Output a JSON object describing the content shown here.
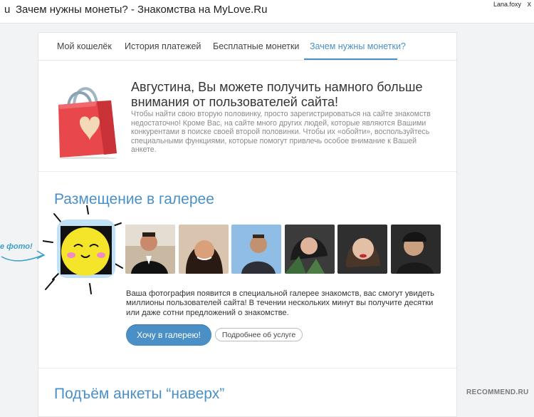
{
  "browser": {
    "tab_fragment": "u",
    "title": "Зачем нужны монеты? - Знакомства на MyLove.Ru",
    "user": "Lana.foxy",
    "close_glyph": "x"
  },
  "tabs": [
    {
      "label": "Мой кошелёк",
      "active": false
    },
    {
      "label": "История платежей",
      "active": false
    },
    {
      "label": "Бесплатные монетки",
      "active": false
    },
    {
      "label": "Зачем нужны монетки?",
      "active": true
    }
  ],
  "intro": {
    "headline": "Августина, Вы можете получить намного больше внимания от пользователей сайта!",
    "text": "Чтобы найти свою вторую половинку, просто зарегистрироваться на сайте знакомств недостаточно! Кроме Вас, на сайте много других людей, которые являются Вашими конкурентами в поиске своей второй половинки. Чтобы их «обойти», воспользуйтесь специальными функциями, которые помогут привлечь особое внимание к Вашей анкете.",
    "icon": "shopping-bag-heart-icon"
  },
  "gallery": {
    "title": "Размещение в галерее",
    "description": "Ваша фотография появится в специальной галерее знакомств, вас смогут увидеть миллионы пользователей сайта! В течении нескольких минут вы получите десятки или даже сотни предложений о знакомстве.",
    "primary_button": "Хочу в галерею!",
    "secondary_button": "Подробнее об услуге",
    "hint_text": "е фото!"
  },
  "boost": {
    "title": "Подъём анкеты “наверх”"
  },
  "watermark": "RECOMMEND.RU",
  "colors": {
    "accent": "#4a90c6",
    "bag": "#e8474c",
    "sun": "#f5e52a",
    "sun_frame": "#bfe0f5"
  }
}
